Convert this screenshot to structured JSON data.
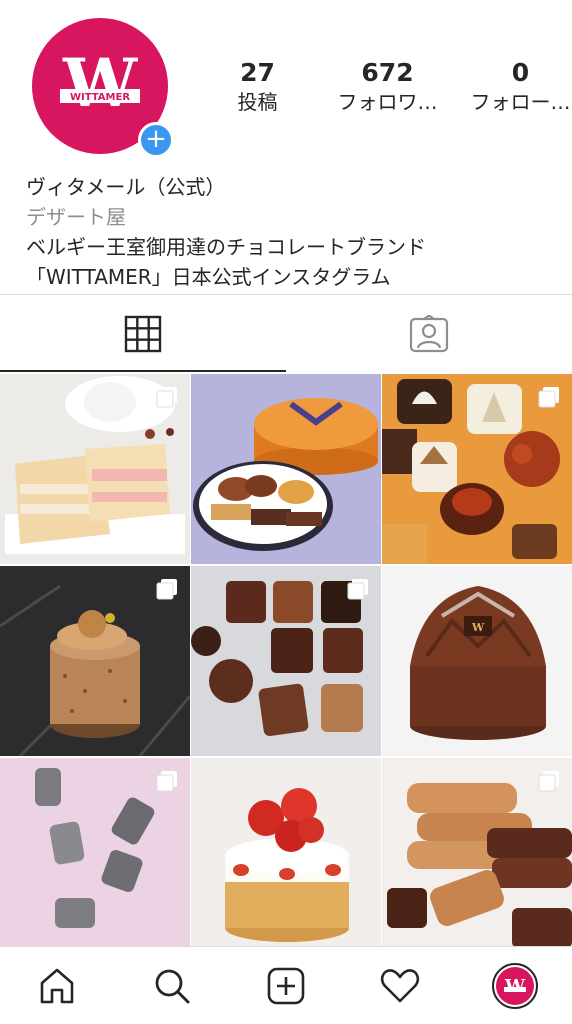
{
  "profile": {
    "brand_mark": "W",
    "brand_wordmark": "WITTAMER",
    "brand_color": "#d8165f",
    "add_badge_icon": "plus-icon",
    "stats": [
      {
        "value": "27",
        "label": "投稿"
      },
      {
        "value": "672",
        "label": "フォロワ…"
      },
      {
        "value": "0",
        "label": "フォロー…"
      }
    ],
    "name": "ヴィタメール（公式）",
    "category": "デザート屋",
    "bio_lines": [
      "ベルギー王室御用達のチョコレートブランド",
      "「WITTAMER」日本公式インスタグラム"
    ]
  },
  "tabs": [
    {
      "icon": "grid-icon",
      "active": true
    },
    {
      "icon": "tagged-person-icon",
      "active": false
    }
  ],
  "grid_posts": [
    {
      "subject": "cakes",
      "multiple": true
    },
    {
      "subject": "gift-box",
      "multiple": false
    },
    {
      "subject": "chocolates",
      "multiple": true
    },
    {
      "subject": "caramel-cake",
      "multiple": true
    },
    {
      "subject": "chocolate-assortment",
      "multiple": true
    },
    {
      "subject": "chocolate-dome-cake",
      "multiple": false
    },
    {
      "subject": "silver-candies",
      "multiple": true
    },
    {
      "subject": "strawberry-shortcake",
      "multiple": false
    },
    {
      "subject": "langue-de-chat",
      "multiple": true
    }
  ],
  "bottom_nav": [
    {
      "icon": "home-icon"
    },
    {
      "icon": "search-icon"
    },
    {
      "icon": "new-post-icon"
    },
    {
      "icon": "heart-icon"
    },
    {
      "icon": "profile-avatar-icon"
    }
  ],
  "colors": {
    "accent_blue": "#3897f0",
    "text": "#262626",
    "secondary_text": "#8e8e8e",
    "divider": "#dbdbdb"
  }
}
